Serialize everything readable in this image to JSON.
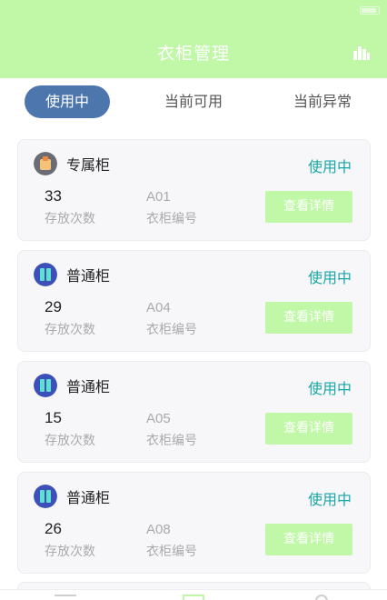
{
  "status_bar": {
    "left_text": "",
    "right_text": ""
  },
  "header": {
    "title": "衣柜管理",
    "right_icon": "bar-chart-icon"
  },
  "tabs": [
    {
      "label": "使用中",
      "active": true
    },
    {
      "label": "当前可用",
      "active": false
    },
    {
      "label": "当前异常",
      "active": false
    }
  ],
  "labels": {
    "count_label": "存放次数",
    "code_label": "衣柜编号",
    "detail_button": "查看详情"
  },
  "cards": [
    {
      "type": "专属柜",
      "icon": "exclusive-locker-icon",
      "status": "使用中",
      "count": "33",
      "code": "A01"
    },
    {
      "type": "普通柜",
      "icon": "locker-icon",
      "status": "使用中",
      "count": "29",
      "code": "A04"
    },
    {
      "type": "普通柜",
      "icon": "locker-icon",
      "status": "使用中",
      "count": "15",
      "code": "A05"
    },
    {
      "type": "普通柜",
      "icon": "locker-icon",
      "status": "使用中",
      "count": "26",
      "code": "A08"
    }
  ],
  "colors": {
    "header_bg": "#c1f8a8",
    "tab_active_bg": "#4d76ad",
    "status_text": "#1aa6a6",
    "button_bg": "#c1f8a8",
    "card_bg": "#f7f7f9"
  }
}
